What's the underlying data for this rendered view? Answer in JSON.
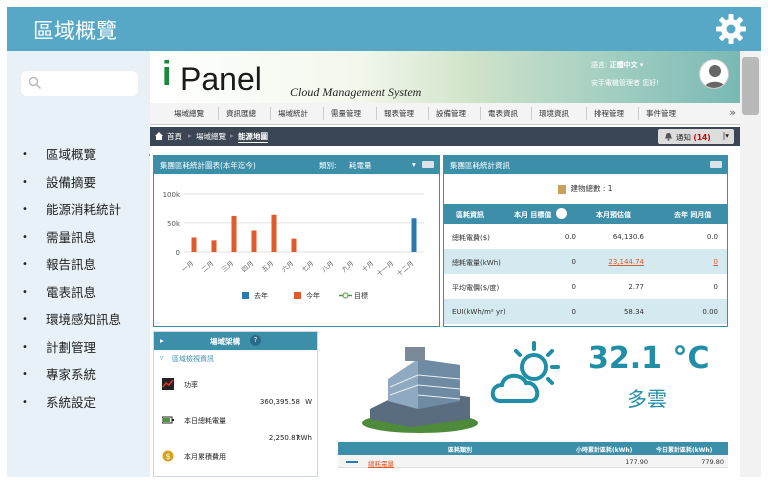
{
  "header": {
    "title": "區域概覽"
  },
  "sidebar": {
    "items": [
      "區域概覽",
      "設備摘要",
      "能源消耗統計",
      "需量訊息",
      "報告訊息",
      "電表訊息",
      "環境感知訊息",
      "計劃管理",
      "專家系統",
      "系統設定"
    ]
  },
  "brand": {
    "logo_i": "i",
    "logo_panel": "Panel",
    "subtitle": "Cloud Management System",
    "lang_label": "語言:",
    "lang_value": "正體中文",
    "welcome": "安手電機管理者 您好!"
  },
  "menu": {
    "items": [
      "場域總覽",
      "資訊匯總",
      "場域統計",
      "需量管理",
      "報表管理",
      "設備管理",
      "電表資訊",
      "環境資訊",
      "排程管理",
      "事件管理"
    ],
    "more": "»"
  },
  "breadcrumb": {
    "home": "首頁",
    "level1": "場域總覽",
    "current": "能源地圖",
    "notify_label": "通知",
    "notify_count": "(14)"
  },
  "chart_panel": {
    "title": "集團區耗統計圖表(本年迄今)",
    "filter_label": "類別:",
    "filter_value": "耗電量"
  },
  "chart_data": {
    "type": "bar",
    "categories": [
      "一月",
      "二月",
      "三月",
      "四月",
      "五月",
      "六月",
      "七月",
      "八月",
      "九月",
      "十月",
      "十一月",
      "十二月"
    ],
    "series": [
      {
        "name": "去年",
        "color": "#2a7ab0",
        "values": [
          0,
          0,
          0,
          0,
          0,
          0,
          0,
          0,
          0,
          0,
          0,
          58000
        ]
      },
      {
        "name": "今年",
        "color": "#e05a2b",
        "values": [
          25000,
          20000,
          62000,
          37000,
          64000,
          23000,
          0,
          0,
          0,
          0,
          0,
          0
        ]
      },
      {
        "name": "目標",
        "color": "#4a9a3a",
        "values": [
          0,
          0,
          0,
          0,
          0,
          0,
          0,
          0,
          0,
          0,
          0,
          0
        ]
      }
    ],
    "yticks": [
      "100k",
      "50k",
      "0"
    ],
    "ylim": [
      0,
      110000
    ],
    "grid": true,
    "legend": "bottom"
  },
  "stats_panel": {
    "title": "集團區耗統計資訊",
    "building_count": "建物總數 : 1",
    "headers": [
      "區耗資訊",
      "本月 目標值",
      "本月預估值",
      "去年 同月值"
    ],
    "rows": [
      {
        "label": "總耗電費($)",
        "target": "0.0",
        "estimate": "64,130.6",
        "last_year": "0.0",
        "link": false
      },
      {
        "label": "總耗電量(kWh)",
        "target": "0",
        "estimate": "23,144.74",
        "last_year": "0",
        "link": true
      },
      {
        "label": "平均電價($/度)",
        "target": "0",
        "estimate": "2.77",
        "last_year": "0",
        "link": false
      },
      {
        "label": "EUI(kWh/m² yr)",
        "target": "0",
        "estimate": "58.34",
        "last_year": "0.00",
        "link": false
      }
    ]
  },
  "org_panel": {
    "title": "場域架構",
    "help": "?",
    "subtitle": "區域檢視資訊",
    "kpis": [
      {
        "label": "功率",
        "value": "360,395.58",
        "unit": "W",
        "icon": "chart-icon"
      },
      {
        "label": "本日總耗電量",
        "value": "2,250.87",
        "unit": "kWh",
        "icon": "battery-icon"
      },
      {
        "label": "本月累積費用",
        "value": "",
        "unit": "",
        "icon": "money-icon"
      }
    ]
  },
  "weather": {
    "temperature": "32.1 °C",
    "condition": "多雲"
  },
  "load_table": {
    "headers": [
      "區耗類別",
      "小時累計區耗(kWh)",
      "今日累計區耗(kWh)"
    ],
    "rows": [
      {
        "label": "總耗電量",
        "hour": "177.90",
        "today": "779.80"
      }
    ]
  },
  "colors": {
    "header": "#57a8c7",
    "panel": "#3c8ea9",
    "accent": "#1f8ea6",
    "this_year": "#e05a2b",
    "last_year": "#2a7ab0",
    "target": "#4a9a3a"
  }
}
